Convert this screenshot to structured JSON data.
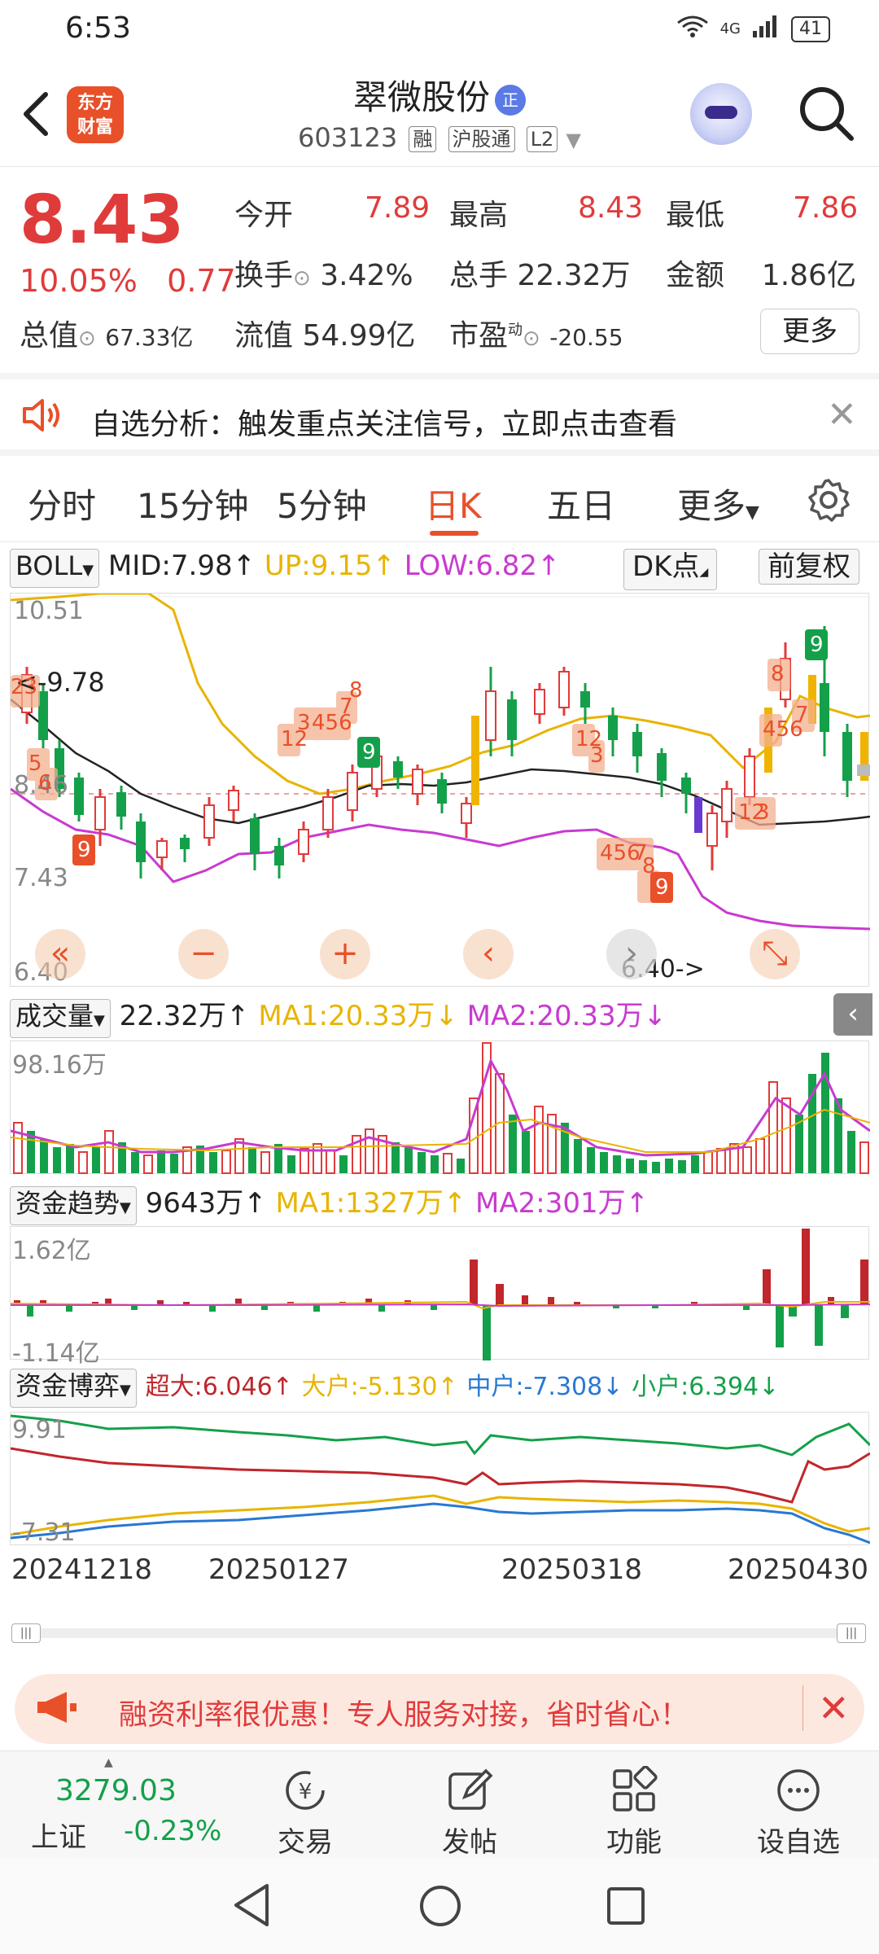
{
  "status_bar": {
    "time": "6:53",
    "network": "4G",
    "battery": "41"
  },
  "header": {
    "logo_line1": "东方",
    "logo_line2": "财富",
    "stock_name": "翠微股份",
    "zheng_badge": "正",
    "code": "603123",
    "tags": [
      "融",
      "沪股通",
      "L2"
    ]
  },
  "quote": {
    "price": "8.43",
    "change_pct": "10.05%",
    "change_amt": "0.77",
    "open_label": "今开",
    "open": "7.89",
    "high_label": "最高",
    "high": "8.43",
    "low_label": "最低",
    "low": "7.86",
    "turnover_label": "换手",
    "turnover": "3.42%",
    "volume_label": "总手",
    "volume": "22.32万",
    "amount_label": "金额",
    "amount": "1.86亿",
    "mktcap_label": "总值",
    "mktcap": "67.33亿",
    "float_label": "流值",
    "float_cap": "54.99亿",
    "pe_label": "市盈",
    "pe_sup": "动",
    "pe": "-20.55",
    "more": "更多"
  },
  "notice": {
    "text": "自选分析：触发重点关注信号，立即点击查看"
  },
  "tabs": [
    "分时",
    "15分钟",
    "5分钟",
    "日K",
    "五日",
    "更多"
  ],
  "active_tab": "日K",
  "boll": {
    "selector": "BOLL",
    "mid": "MID:7.98↑",
    "up": "UP:9.15↑",
    "low": "LOW:6.82↑",
    "dk_button": "DK点",
    "fq_button": "前复权",
    "y_labels": [
      "10.51",
      "8.46",
      "7.43",
      "6.40"
    ],
    "ref_label": "<-9.78",
    "min_label": "6.40->",
    "seq_numbers": [
      "23",
      "5",
      "6",
      "9",
      "12",
      "3",
      "456",
      "7",
      "8",
      "9",
      "12",
      "3",
      "456",
      "7",
      "8",
      "9",
      "12",
      "3",
      "456",
      "7",
      "8",
      "9"
    ]
  },
  "volume": {
    "selector": "成交量",
    "value": "22.32万↑",
    "ma1": "MA1:20.33万↓",
    "ma2": "MA2:20.33万↓",
    "max_label": "98.16万"
  },
  "fund_trend": {
    "selector": "资金趋势",
    "value": "9643万↑",
    "ma1": "MA1:1327万↑",
    "ma2": "MA2:301万↑",
    "max_label": "1.62亿",
    "min_label": "-1.14亿"
  },
  "fund_game": {
    "selector": "资金博弈",
    "super": "超大:6.046↑",
    "large": "大户:-5.130↑",
    "mid": "中户:-7.308↓",
    "small": "小户:6.394↓",
    "max_label": "9.91",
    "min_label": "-7.31"
  },
  "dates": [
    "20241218",
    "20250127",
    "20250318",
    "20250430"
  ],
  "promo": {
    "text": "融资利率很优惠！专人服务对接，省时省心！"
  },
  "bottom": {
    "index_value": "3279.03",
    "index_name": "上证",
    "index_change": "-0.23%",
    "items": [
      "交易",
      "发帖",
      "功能",
      "设自选"
    ]
  },
  "colors": {
    "up": "#e03b3b",
    "down": "#14a04a",
    "accent": "#e8502a",
    "mid_line": "#222222",
    "up_band": "#e8b400",
    "low_band": "#c83ad0"
  }
}
